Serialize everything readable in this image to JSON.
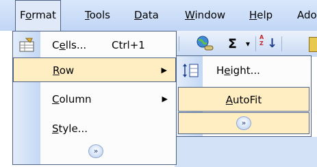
{
  "menubar": {
    "items": [
      {
        "label": "Format",
        "accel": "o"
      },
      {
        "label": "Tools",
        "accel": "T"
      },
      {
        "label": "Data",
        "accel": "D"
      },
      {
        "label": "Window",
        "accel": "W"
      },
      {
        "label": "Help",
        "accel": "H"
      },
      {
        "label": "Ado"
      }
    ]
  },
  "toolbar": {
    "sigma": "Σ",
    "dropdown": "▾",
    "sort": "↓",
    "sort_az": "A Z"
  },
  "format_menu": {
    "items": [
      {
        "label": "Cells...",
        "accel": "e",
        "shortcut": "Ctrl+1"
      },
      {
        "label": "Row",
        "accel": "R",
        "arrow": "▶"
      },
      {
        "label": "Column",
        "accel": "C",
        "arrow": "▶"
      },
      {
        "label": "Style...",
        "accel": "S"
      }
    ],
    "expand": "»"
  },
  "row_submenu": {
    "items": [
      {
        "label": "Height...",
        "accel": "e"
      },
      {
        "label": "AutoFit",
        "accel": "A"
      }
    ],
    "expand": "»"
  }
}
